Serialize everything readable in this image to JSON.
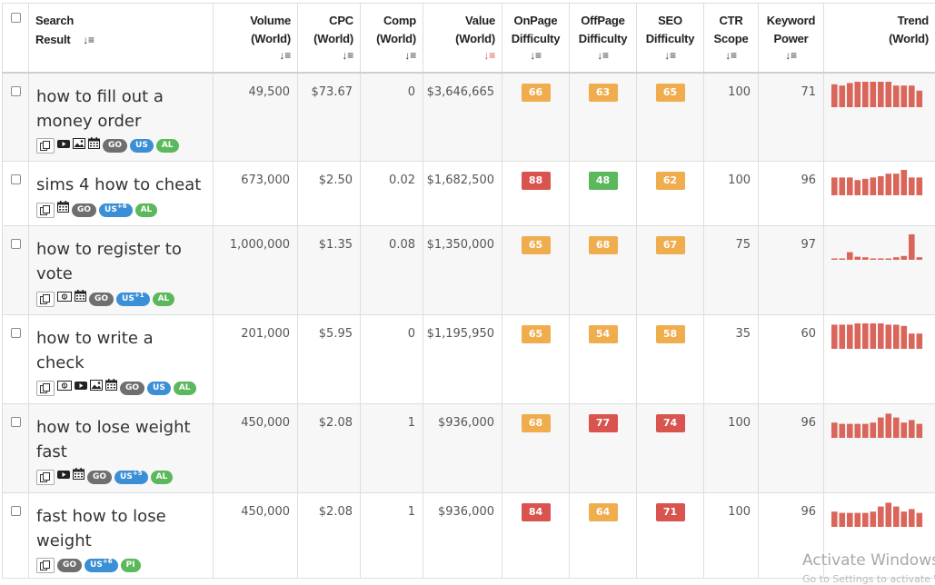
{
  "headers": {
    "select_all": "",
    "search_result": [
      "Search",
      "Result"
    ],
    "volume": [
      "Volume",
      "(World)"
    ],
    "cpc": [
      "CPC",
      "(World)"
    ],
    "comp": [
      "Comp",
      "(World)"
    ],
    "value": [
      "Value",
      "(World)"
    ],
    "onpage": [
      "OnPage",
      "Difficulty"
    ],
    "offpage": [
      "OffPage",
      "Difficulty"
    ],
    "seo": [
      "SEO",
      "Difficulty"
    ],
    "ctr": [
      "CTR",
      "Scope"
    ],
    "power": [
      "Keyword",
      "Power"
    ],
    "trend": [
      "Trend",
      "(World)"
    ]
  },
  "colors": {
    "orange": "#f0ad4e",
    "red": "#d9534f",
    "green": "#5cb85c",
    "trend_bar": "#d9655b",
    "go_pill": "#6f6f6f",
    "us_pill": "#3a8fd6",
    "al_pill": "#5cb85c"
  },
  "rows": [
    {
      "keyword": [
        "how to fill out a",
        "money order"
      ],
      "icons": [
        "copy-icon",
        "youtube-icon",
        "image-icon",
        "calendar-icon"
      ],
      "pills": [
        {
          "t": "GO",
          "k": "go"
        },
        {
          "t": "US",
          "k": "us",
          "sup": ""
        },
        {
          "t": "AL",
          "k": "al"
        }
      ],
      "volume": "49,500",
      "cpc": "$73.67",
      "comp": "0",
      "value": "$3,646,665",
      "onpage": {
        "v": "66",
        "c": "orange"
      },
      "offpage": {
        "v": "63",
        "c": "orange"
      },
      "seo": {
        "v": "65",
        "c": "orange"
      },
      "ctr": "100",
      "power": "71",
      "trend": [
        0.9,
        0.85,
        0.95,
        1,
        1,
        1,
        1,
        1,
        0.85,
        0.85,
        0.85,
        0.65
      ]
    },
    {
      "keyword": [
        "sims 4 how to cheat"
      ],
      "icons": [
        "copy-icon",
        "calendar-icon"
      ],
      "pills": [
        {
          "t": "GO",
          "k": "go"
        },
        {
          "t": "US",
          "k": "us",
          "sup": "+6"
        },
        {
          "t": "AL",
          "k": "al"
        }
      ],
      "volume": "673,000",
      "cpc": "$2.50",
      "comp": "0.02",
      "value": "$1,682,500",
      "onpage": {
        "v": "88",
        "c": "red"
      },
      "offpage": {
        "v": "48",
        "c": "green"
      },
      "seo": {
        "v": "62",
        "c": "orange"
      },
      "ctr": "100",
      "power": "96",
      "trend": [
        0.7,
        0.7,
        0.7,
        0.6,
        0.65,
        0.7,
        0.75,
        0.85,
        0.85,
        1,
        0.7,
        0.7
      ]
    },
    {
      "keyword": [
        "how to register to",
        "vote"
      ],
      "icons": [
        "copy-icon",
        "money-icon",
        "calendar-icon"
      ],
      "pills": [
        {
          "t": "GO",
          "k": "go"
        },
        {
          "t": "US",
          "k": "us",
          "sup": "+1"
        },
        {
          "t": "AL",
          "k": "al"
        }
      ],
      "volume": "1,000,000",
      "cpc": "$1.35",
      "comp": "0.08",
      "value": "$1,350,000",
      "onpage": {
        "v": "65",
        "c": "orange"
      },
      "offpage": {
        "v": "68",
        "c": "orange"
      },
      "seo": {
        "v": "67",
        "c": "orange"
      },
      "ctr": "75",
      "power": "97",
      "trend": [
        0.05,
        0.05,
        0.3,
        0.12,
        0.1,
        0.05,
        0.05,
        0.05,
        0.1,
        0.15,
        1,
        0.1
      ]
    },
    {
      "keyword": [
        "how to write a check"
      ],
      "icons": [
        "copy-icon",
        "money-icon",
        "youtube-icon",
        "image-icon",
        "calendar-icon"
      ],
      "pills": [
        {
          "t": "GO",
          "k": "go"
        },
        {
          "t": "US",
          "k": "us",
          "sup": ""
        },
        {
          "t": "AL",
          "k": "al"
        }
      ],
      "volume": "201,000",
      "cpc": "$5.95",
      "comp": "0",
      "value": "$1,195,950",
      "onpage": {
        "v": "65",
        "c": "orange"
      },
      "offpage": {
        "v": "54",
        "c": "orange"
      },
      "seo": {
        "v": "58",
        "c": "orange"
      },
      "ctr": "35",
      "power": "60",
      "trend": [
        0.95,
        0.95,
        0.95,
        1,
        1,
        1,
        1,
        0.95,
        0.95,
        0.9,
        0.6,
        0.6
      ]
    },
    {
      "keyword": [
        "how to lose weight",
        "fast"
      ],
      "icons": [
        "copy-icon",
        "youtube-icon",
        "calendar-icon"
      ],
      "pills": [
        {
          "t": "GO",
          "k": "go"
        },
        {
          "t": "US",
          "k": "us",
          "sup": "+5"
        },
        {
          "t": "AL",
          "k": "al"
        }
      ],
      "volume": "450,000",
      "cpc": "$2.08",
      "comp": "1",
      "value": "$936,000",
      "onpage": {
        "v": "68",
        "c": "orange"
      },
      "offpage": {
        "v": "77",
        "c": "red"
      },
      "seo": {
        "v": "74",
        "c": "red"
      },
      "ctr": "100",
      "power": "96",
      "trend": [
        0.6,
        0.55,
        0.55,
        0.55,
        0.55,
        0.6,
        0.8,
        0.95,
        0.8,
        0.6,
        0.7,
        0.55
      ]
    },
    {
      "keyword": [
        "fast how to lose",
        "weight"
      ],
      "icons": [
        "copy-icon"
      ],
      "pills": [
        {
          "t": "GO",
          "k": "go"
        },
        {
          "t": "US",
          "k": "us",
          "sup": "+6"
        },
        {
          "t": "PI",
          "k": "al"
        }
      ],
      "volume": "450,000",
      "cpc": "$2.08",
      "comp": "1",
      "value": "$936,000",
      "onpage": {
        "v": "84",
        "c": "red"
      },
      "offpage": {
        "v": "64",
        "c": "orange"
      },
      "seo": {
        "v": "71",
        "c": "red"
      },
      "ctr": "100",
      "power": "96",
      "trend": [
        0.6,
        0.55,
        0.55,
        0.55,
        0.55,
        0.6,
        0.8,
        0.95,
        0.8,
        0.6,
        0.7,
        0.55
      ]
    }
  ],
  "watermark": {
    "line1": "Activate Windows",
    "line2": "Go to Settings to activate Windows."
  }
}
